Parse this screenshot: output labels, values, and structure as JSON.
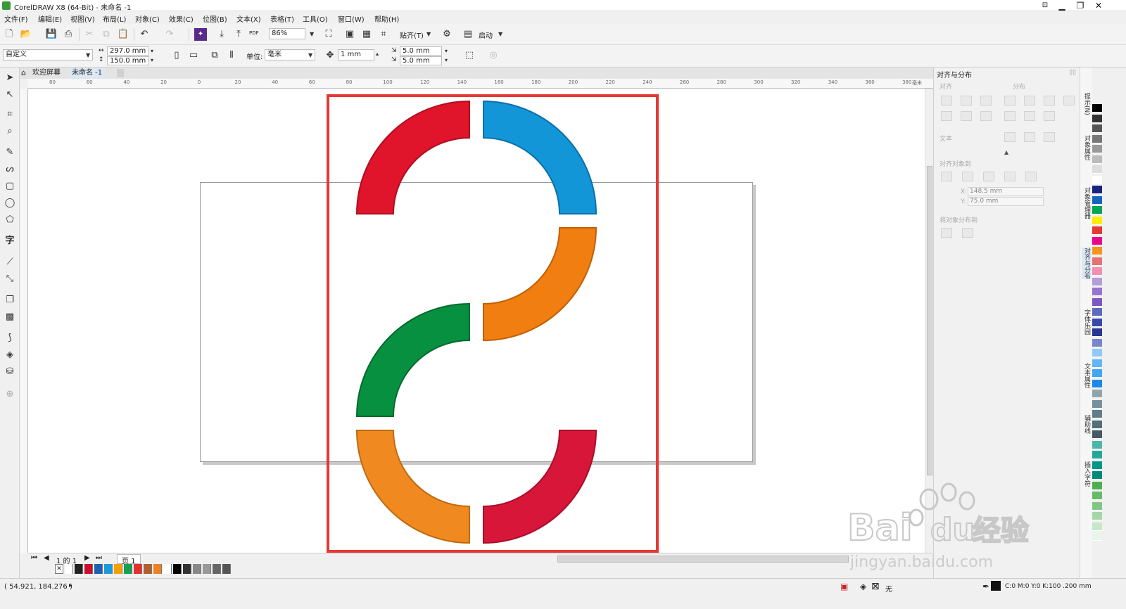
{
  "window": {
    "title": "CorelDRAW X8 (64-Bit) - 未命名 -1",
    "controls": [
      "▁",
      "❐",
      "✕"
    ]
  },
  "menu": [
    "文件(F)",
    "编辑(E)",
    "视图(V)",
    "布局(L)",
    "对象(C)",
    "效果(C)",
    "位图(B)",
    "文本(X)",
    "表格(T)",
    "工具(O)",
    "窗口(W)",
    "帮助(H)"
  ],
  "toolbar1": {
    "zoom": "86%",
    "snap_label": "贴齐(T)",
    "launch_label": "启动",
    "pdf_label": "PDF"
  },
  "toolbar2": {
    "preset": "自定义",
    "width": "297.0 mm",
    "height": "150.0 mm",
    "unit_label": "单位:",
    "unit": "毫米",
    "nudge": "1 mm",
    "dup_x": "5.0 mm",
    "dup_y": "5.0 mm"
  },
  "doc_tabs": [
    "欢迎屏幕",
    "未命名 -1"
  ],
  "ruler": {
    "h_labels": [
      "80",
      "60",
      "40",
      "20",
      "0",
      "20",
      "40",
      "60",
      "80",
      "100",
      "120",
      "140",
      "160",
      "180",
      "200",
      "220",
      "240",
      "260",
      "280",
      "300",
      "320",
      "340",
      "360",
      "380"
    ],
    "unit": "毫米"
  },
  "page_nav": {
    "page_text": "1 的 1",
    "page_tab": "页 1"
  },
  "status": {
    "coords": "( 54.921, 184.276 )",
    "fill": "无",
    "outline": "C:0 M:0 Y:0 K:100  .200 mm"
  },
  "docker": {
    "title": "对齐与分布",
    "sections": {
      "align": "对齐",
      "distribute": "分布",
      "text": "文本",
      "align_objects_to": "对齐对象到",
      "distribute_objects_to": "将对象分布到"
    },
    "x_value": "148.5 mm",
    "y_value": "75.0 mm"
  },
  "docker_tabs": [
    "提示(N)",
    "对象属性",
    "对象管理器",
    "对齐与分布",
    "字体乐园",
    "文本属性",
    "辅助线",
    "插入字符"
  ],
  "colors": {
    "red": "#e0142a",
    "blue": "#1296d8",
    "orange": "#f07e10",
    "green": "#079040",
    "orange2": "#f08a20",
    "red2": "#d8163a",
    "highlight": "#e53935"
  },
  "palette_bottom": [
    "#ffffff",
    "#222222",
    "#c8102e",
    "#2060b0",
    "#1a9ad8",
    "#f5a000",
    "#18a050",
    "#e53030",
    "#b06030",
    "#f08020",
    "#ffffff",
    "#000000",
    "#333333",
    "#888888",
    "#999999",
    "#666666",
    "#555555"
  ],
  "palette_right": [
    "#000000",
    "#333333",
    "#555555",
    "#777777",
    "#999999",
    "#bbbbbb",
    "#dddddd",
    "#ffffff",
    "#1a237e",
    "#1565c0",
    "#00a651",
    "#ffeb00",
    "#e53935",
    "#ec008c",
    "#f7941d",
    "#e57373",
    "#f48fb1",
    "#b39ddb",
    "#9575cd",
    "#7e57c2",
    "#5c6bc0",
    "#3949ab",
    "#283593",
    "#7986cb",
    "#90caf9",
    "#64b5f6",
    "#42a5f5",
    "#1e88e5",
    "#90a4ae",
    "#78909c",
    "#607d8b",
    "#546e7a",
    "#455a64",
    "#4db6ac",
    "#26a69a",
    "#009688",
    "#00897b",
    "#4caf50",
    "#66bb6a",
    "#81c784",
    "#a5d6a7",
    "#c8e6c9",
    "#e8f5e9"
  ],
  "watermark": {
    "brand": "Bai",
    "brand2": "du",
    "cn": "经验",
    "url": "jingyan.baidu.com"
  }
}
